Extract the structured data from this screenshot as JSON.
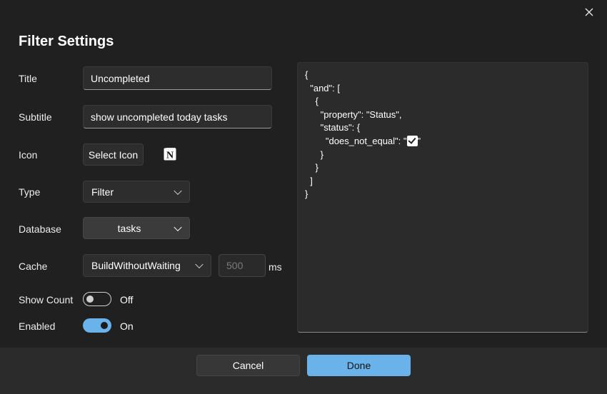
{
  "dialog": {
    "title": "Filter Settings",
    "close_icon": "close-icon"
  },
  "fields": {
    "title_label": "Title",
    "title_value": "Uncompleted",
    "subtitle_label": "Subtitle",
    "subtitle_value": "show uncompleted today tasks",
    "icon_label": "Icon",
    "select_icon_label": "Select Icon",
    "selected_icon": "notion-icon",
    "type_label": "Type",
    "type_value": "Filter",
    "database_label": "Database",
    "database_value": "tasks",
    "cache_label": "Cache",
    "cache_value": "BuildWithoutWaiting",
    "cache_ms_value": "500",
    "cache_unit": "ms",
    "show_count_label": "Show Count",
    "show_count_state": "Off",
    "enabled_label": "Enabled",
    "enabled_state": "On"
  },
  "code": {
    "lines": [
      "{",
      "  \"and\": [",
      "    {",
      "      \"property\": \"Status\",",
      "      \"status\": {",
      "        \"does_not_equal\": \"",
      "      }",
      "    }",
      "  ]",
      "}"
    ],
    "line6_suffix": "\""
  },
  "footer": {
    "cancel_label": "Cancel",
    "done_label": "Done"
  },
  "colors": {
    "accent": "#6ab3ea",
    "background": "#202020",
    "footer": "#2b2b2b"
  }
}
